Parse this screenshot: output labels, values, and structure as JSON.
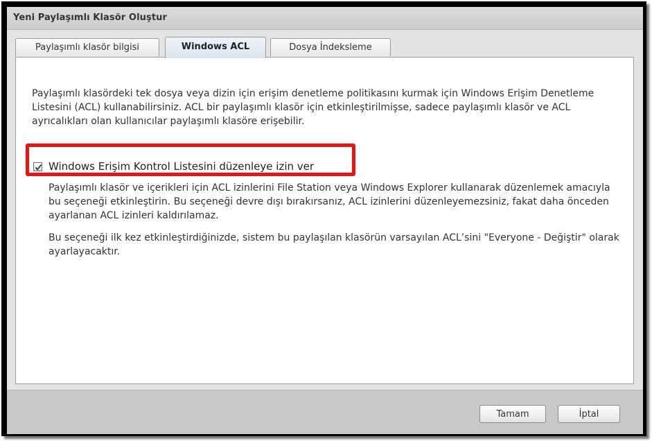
{
  "window": {
    "title": "Yeni Paylaşımlı Klasör Oluştur"
  },
  "tabs": [
    {
      "label": "Paylaşımlı klasör bilgisi",
      "active": false
    },
    {
      "label": "Windows ACL",
      "active": true
    },
    {
      "label": "Dosya İndeksleme",
      "active": false
    }
  ],
  "content": {
    "intro": "Paylaşımlı klasördeki tek dosya veya dizin için erişim denetleme politikasını kurmak için Windows Erişim Denetleme Listesini (ACL) kullanabilirsiniz. ACL bir paylaşımlı klasör için etkinleştirilmişse, sadece paylaşımlı klasör ve ACL ayrıcalıkları olan kullanıcılar paylaşımlı klasöre erişebilir.",
    "checkbox_label": "Windows Erişim Kontrol Listesini düzenleye izin ver",
    "checkbox_checked": true,
    "description_1": "Paylaşımlı klasör ve içerikleri için ACL izinlerini File Station veya Windows Explorer kullanarak düzenlemek amacıyla bu seçeneği etkinleştirin. Bu seçeneği devre dışı bırakırsanız, ACL izinlerini düzenleyemezsiniz, fakat daha önceden ayarlanan ACL izinleri kaldırılamaz.",
    "description_2": "Bu seçeneği ilk kez etkinleştirdiğinizde, sistem bu paylaşılan klasörün varsayılan ACL’sini \"Everyone - Değiştir\" olarak ayarlayacaktır."
  },
  "buttons": {
    "ok": "Tamam",
    "cancel": "İptal"
  },
  "colors": {
    "highlight": "#ee1111",
    "active_tab": "#dbe4ee"
  }
}
